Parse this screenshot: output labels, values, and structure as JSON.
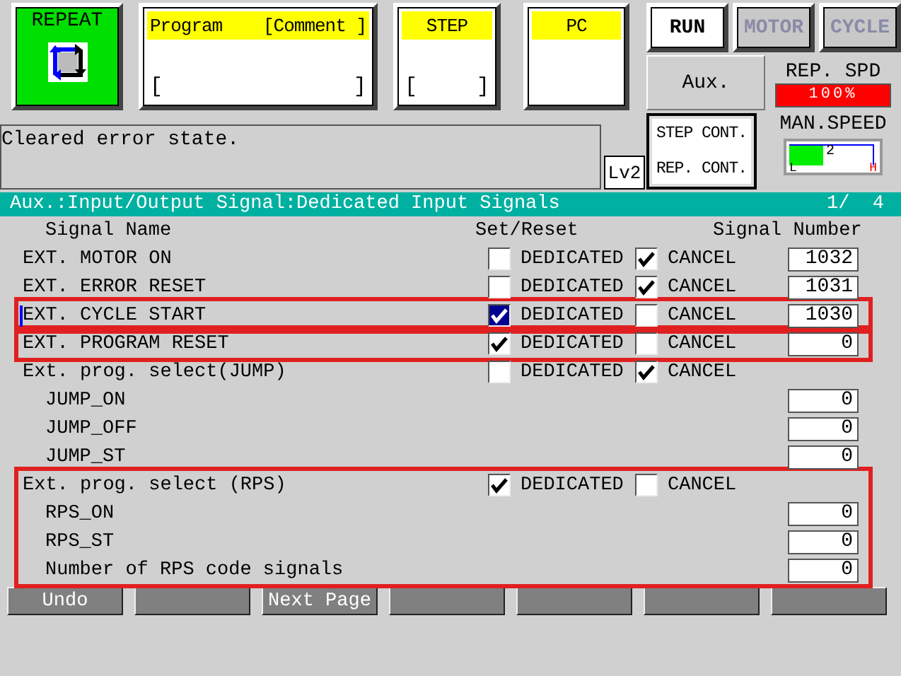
{
  "mode_tile": {
    "label": "REPEAT"
  },
  "info_tiles": [
    {
      "title": "Program",
      "comment": "[Comment ]",
      "brackets": [
        "[",
        "]"
      ]
    },
    {
      "title": "STEP",
      "brackets": [
        "[",
        "]"
      ]
    },
    {
      "title": "PC"
    }
  ],
  "status_buttons": [
    {
      "label": "RUN",
      "on": true
    },
    {
      "label": "MOTOR",
      "on": false
    },
    {
      "label": "CYCLE",
      "on": false
    }
  ],
  "aux_button": "Aux.",
  "rep_speed": {
    "label": "REP. SPD",
    "value": "100%"
  },
  "message": "Cleared error state.",
  "access_level": "Lv2",
  "cont_button": {
    "lines": [
      "STEP CONT.",
      "REP. CONT."
    ]
  },
  "man_speed": {
    "label": "MAN.SPEED",
    "level": 0.4,
    "value": "2",
    "low": "L",
    "high": "H"
  },
  "header": {
    "title": "Aux.:Input/Output Signal:Dedicated Input Signals",
    "page": "1/  4"
  },
  "columns": [
    "Signal Name",
    "Set/Reset",
    "Signal Number"
  ],
  "sections": [
    {
      "highlighted": false,
      "rows": [
        {
          "name": "EXT. MOTOR ON",
          "selected": false,
          "set": {
            "label": "DEDICATED",
            "checked": false
          },
          "reset": {
            "label": "CANCEL",
            "checked": true
          },
          "number": "1032"
        },
        {
          "name": "EXT. ERROR RESET",
          "selected": false,
          "set": {
            "label": "DEDICATED",
            "checked": false
          },
          "reset": {
            "label": "CANCEL",
            "checked": true
          },
          "number": "1031"
        }
      ]
    },
    {
      "highlighted": true,
      "rows": [
        {
          "name": "EXT. CYCLE START",
          "selected": true,
          "set": {
            "label": "DEDICATED",
            "checked": true
          },
          "reset": {
            "label": "CANCEL",
            "checked": false
          },
          "number": "1030"
        }
      ]
    },
    {
      "highlighted": true,
      "rows": [
        {
          "name": "EXT. PROGRAM RESET",
          "selected": false,
          "set": {
            "label": "DEDICATED",
            "checked": true
          },
          "reset": {
            "label": "CANCEL",
            "checked": false
          },
          "number": "0"
        }
      ]
    },
    {
      "highlighted": false,
      "rows": [
        {
          "name": "Ext. prog. select(JUMP)",
          "selected": false,
          "set": {
            "label": "DEDICATED",
            "checked": false
          },
          "reset": {
            "label": "CANCEL",
            "checked": true
          },
          "children": [
            {
              "name": "JUMP_ON",
              "selected": false,
              "number": "0"
            },
            {
              "name": "JUMP_OFF",
              "selected": false,
              "number": "0"
            },
            {
              "name": "JUMP_ST",
              "selected": false,
              "number": "0"
            }
          ]
        }
      ]
    },
    {
      "highlighted": true,
      "rows": [
        {
          "name": "Ext. prog. select (RPS)",
          "selected": false,
          "set": {
            "label": "DEDICATED",
            "checked": true
          },
          "reset": {
            "label": "CANCEL",
            "checked": false
          },
          "children": [
            {
              "name": "RPS_ON",
              "selected": false,
              "number": "0"
            },
            {
              "name": "RPS_ST",
              "selected": false,
              "number": "0"
            },
            {
              "name": "Number of RPS code signals",
              "selected": false,
              "number": "0"
            }
          ]
        }
      ]
    }
  ],
  "soft_keys": [
    {
      "kind": "labeled",
      "label": "Undo"
    },
    {
      "kind": "blank"
    },
    {
      "kind": "labeled",
      "label": "Next Page"
    },
    {
      "kind": "blank"
    },
    {
      "kind": "blank"
    },
    {
      "kind": "blank"
    },
    {
      "kind": "blank"
    }
  ]
}
